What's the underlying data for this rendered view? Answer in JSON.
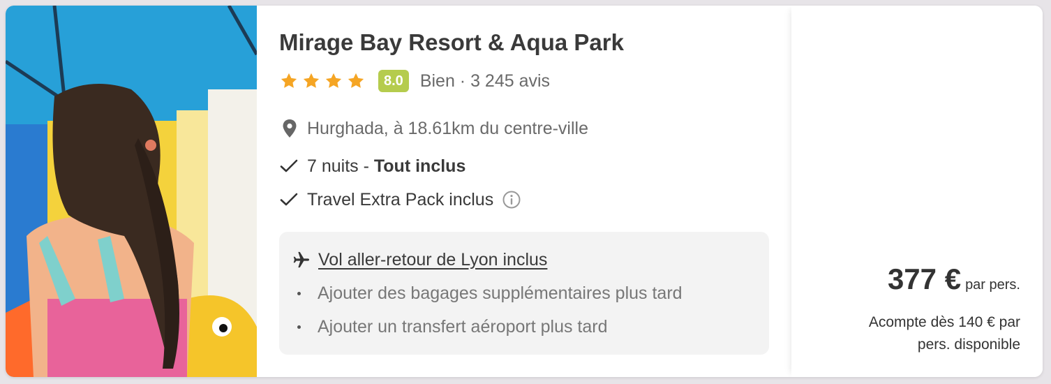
{
  "hotel": {
    "name": "Mirage Bay Resort & Aqua Park",
    "stars": 4,
    "score": "8.0",
    "rating_text": "Bien · 3 245 avis",
    "location": "Hurghada, à 18.61km du centre-ville"
  },
  "inclusions": {
    "nights_prefix": "7 nuits - ",
    "board": "Tout inclus",
    "extra_pack": "Travel Extra Pack inclus"
  },
  "flight": {
    "link": "Vol aller-retour de Lyon inclus",
    "bullets": [
      "Ajouter des bagages supplémentaires plus tard",
      "Ajouter un transfert aéroport plus tard"
    ]
  },
  "pricing": {
    "price": "377 €",
    "per": "par pers.",
    "deposit_line1": "Acompte dès 140 € par",
    "deposit_line2": "pers. disponible"
  },
  "colors": {
    "star": "#f5a524",
    "score_badge": "#b5cc4d",
    "flight_box": "#f3f3f3"
  },
  "icons": [
    "star-icon",
    "location-pin-icon",
    "check-icon",
    "info-icon",
    "airplane-icon"
  ]
}
